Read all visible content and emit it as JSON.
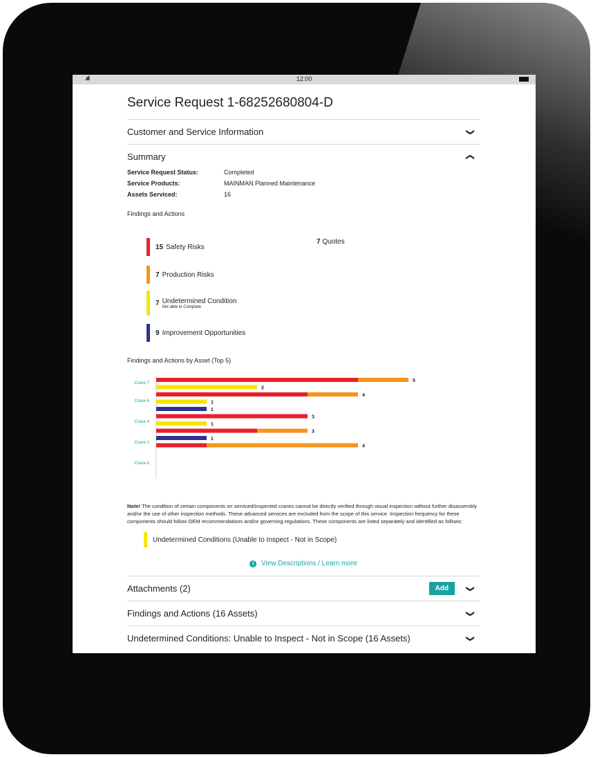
{
  "status_bar": {
    "signal": ".ııl",
    "time": "12:00"
  },
  "page_title": "Service Request 1-68252680804-D",
  "sections": {
    "customer": {
      "label": "Customer and Service Information"
    },
    "summary": {
      "label": "Summary"
    },
    "attachments": {
      "label": "Attachments (2)",
      "add_label": "Add"
    },
    "findings": {
      "label": "Findings and Actions (16 Assets)"
    },
    "undetermined": {
      "label": "Undetermined Conditions: Unable to Inspect - Not in Scope (16 Assets)"
    }
  },
  "summary": {
    "status_key": "Service Request Status:",
    "status_val": "Completed",
    "products_key": "Service Products:",
    "products_val": "MAINMAN Planned Maintenance",
    "assets_key": "Assets Serviced:",
    "assets_val": "16",
    "findings_label": "Findings and Actions"
  },
  "findings": [
    {
      "count": "15",
      "label": "Safety Risks",
      "sub": "",
      "color": "#e8202a"
    },
    {
      "count": "7",
      "label": "Production Risks",
      "sub": "",
      "color": "#f7941d"
    },
    {
      "count": "7",
      "label": "Undetermined Condition",
      "sub": "Not able to Complete",
      "color": "#f5e600"
    },
    {
      "count": "9",
      "label": "Improvement Opportunities",
      "sub": "",
      "color": "#2e3192"
    }
  ],
  "quotes": {
    "count": "7",
    "label": "Quotes"
  },
  "chart_title": "Findings and Actions by Asset (Top 5)",
  "chart_data": {
    "type": "bar",
    "orientation": "horizontal",
    "categories": [
      "Crane 7",
      "Crane 6",
      "Crane 4",
      "Crane 2",
      "Crane 8"
    ],
    "series_colors": {
      "safety": "#e8202a",
      "production": "#f7941d",
      "undetermined": "#f5e600",
      "improvement": "#2e3192"
    },
    "rows": [
      {
        "asset": "Crane 7",
        "segments": [
          {
            "type": "safety",
            "value": 4
          },
          {
            "type": "production",
            "value": 1
          }
        ],
        "label": "5"
      },
      {
        "asset": "Crane 7",
        "segments": [
          {
            "type": "undetermined",
            "value": 2
          }
        ],
        "label": "2"
      },
      {
        "asset": "Crane 6",
        "segments": [
          {
            "type": "safety",
            "value": 3
          },
          {
            "type": "production",
            "value": 1
          }
        ],
        "label": "4"
      },
      {
        "asset": "Crane 6",
        "segments": [
          {
            "type": "undetermined",
            "value": 1
          }
        ],
        "label": "1"
      },
      {
        "asset": "Crane 6",
        "segments": [
          {
            "type": "improvement",
            "value": 1
          }
        ],
        "label": "1"
      },
      {
        "asset": "Crane 4",
        "segments": [
          {
            "type": "safety",
            "value": 3
          }
        ],
        "label": "3"
      },
      {
        "asset": "Crane 4",
        "segments": [
          {
            "type": "undetermined",
            "value": 1
          }
        ],
        "label": "1"
      },
      {
        "asset": "Crane 2",
        "segments": [
          {
            "type": "safety",
            "value": 2
          },
          {
            "type": "production",
            "value": 1
          }
        ],
        "label": "3"
      },
      {
        "asset": "Crane 8",
        "segments": [
          {
            "type": "improvement",
            "value": 1
          }
        ],
        "label": "1"
      },
      {
        "asset": "Crane 8",
        "segments": [
          {
            "type": "safety",
            "value": 1
          },
          {
            "type": "production",
            "value": 3
          }
        ],
        "label": "4"
      }
    ],
    "xlim": [
      0,
      5
    ]
  },
  "note": {
    "bold": "Note!",
    "text": "The condition of certain components on serviced/inspected cranes cannot be directly verified through visual inspection without further disassembly and/or the use of other inspection methods. These advanced services are excluded from the scope of this service. Inspection frequency for these components should follow OEM recommendations and/or governing regulations. These components are listed separately and identified as follows:",
    "legend": "Undetermined Conditions (Unable to Inspect - Not in Scope)"
  },
  "learn_more": "View Descriptions / Learn more"
}
